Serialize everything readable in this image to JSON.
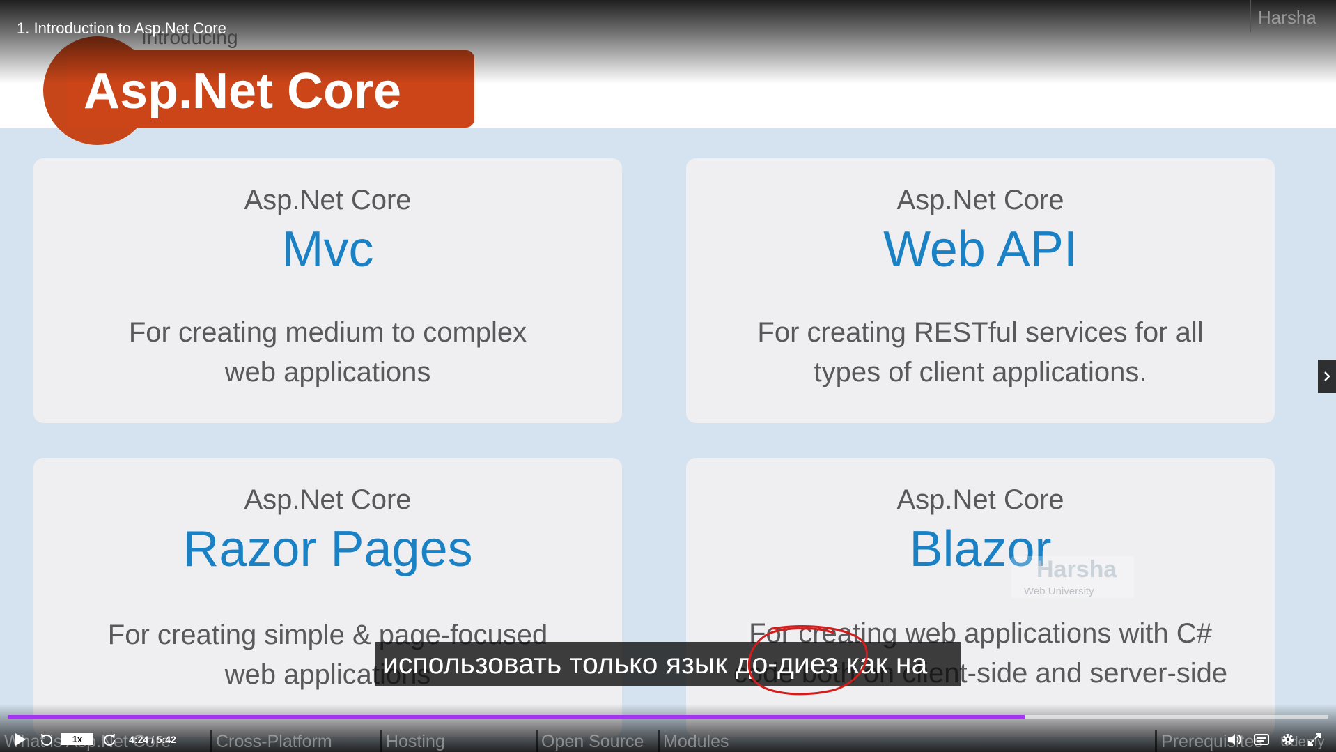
{
  "video": {
    "title": "1. Introduction to Asp.Net Core",
    "brand": "Harsha",
    "current_time": "4:24",
    "duration": "5:42",
    "time_display": "4:24 / 5:42",
    "playback_speed": "1x",
    "progress": 0.77
  },
  "slide": {
    "kicker": "Introducing",
    "logo_text": "Asp.Net Core",
    "cards": [
      {
        "subtitle": "Asp.Net Core",
        "title": "Mvc",
        "desc_line1": "For creating medium to complex",
        "desc_line2": "web applications"
      },
      {
        "subtitle": "Asp.Net Core",
        "title": "Web API",
        "desc_line1": "For creating RESTful services for all",
        "desc_line2": "types of client applications."
      },
      {
        "subtitle": "Asp.Net Core",
        "title": "Razor Pages",
        "desc_line1": "For creating simple & page-focused",
        "desc_line2": "web applications"
      },
      {
        "subtitle": "Asp.Net Core",
        "title": "Blazor",
        "desc_line1": "For creating web applications with C#",
        "desc_line2": "code both on client-side and server-side"
      }
    ],
    "watermark": {
      "name": "Harsha",
      "sub": "Web University"
    }
  },
  "captions": {
    "text": "использовать только язык до-диез как на"
  },
  "chapters": [
    "What is Asp.Net Core",
    "Cross-Platform",
    "Hosting",
    "Open Source",
    "Modules",
    "Prerequisites",
    "Udemy"
  ],
  "colors": {
    "progress": "#a435f0",
    "logo": "#cc4518",
    "card_title": "#1a82c4",
    "slide_bg": "#d4e3ef"
  },
  "icons": {
    "play": "play-icon",
    "rewind": "rewind-icon",
    "forward": "forward-icon",
    "volume": "volume-icon",
    "captions": "captions-icon",
    "settings": "gear-icon",
    "fullscreen": "fullscreen-icon",
    "next": "chevron-right-icon"
  }
}
